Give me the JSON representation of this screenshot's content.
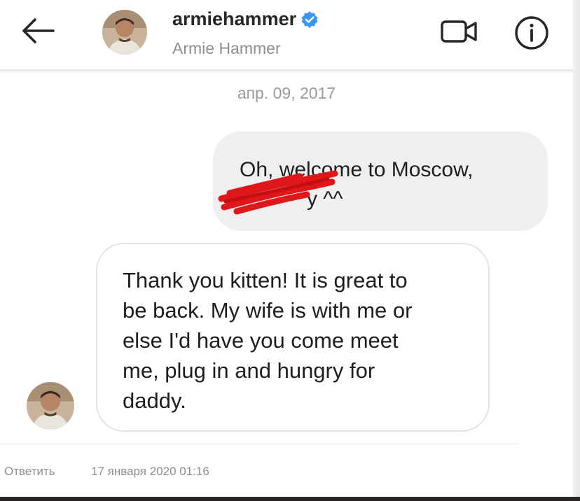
{
  "header": {
    "username": "armiehammer",
    "full_name": "Armie Hammer",
    "verified": true,
    "back_icon": "arrow-left-icon",
    "video_icon": "video-camera-icon",
    "info_icon": "info-circle-icon",
    "verified_color": "#3897f0"
  },
  "conversation": {
    "date_separator": "апр. 09, 2017",
    "messages": [
      {
        "direction": "outgoing",
        "lines": [
          "Oh, welcome to Moscow,",
          "y ^^"
        ],
        "redacted": true
      },
      {
        "direction": "incoming",
        "lines": [
          "Thank you kitten! It is great to",
          "be back. My wife is with me or",
          "else I'd have you come meet",
          "me, plug in and hungry for",
          "daddy."
        ]
      }
    ]
  },
  "footer": {
    "reply_label": "Ответить",
    "timestamp": "17 января 2020 01:16"
  },
  "colors": {
    "outgoing_bubble": "#efefef",
    "incoming_border": "#e3e3e3",
    "muted_text": "#8e8e8e",
    "redaction": "#e0161a"
  }
}
